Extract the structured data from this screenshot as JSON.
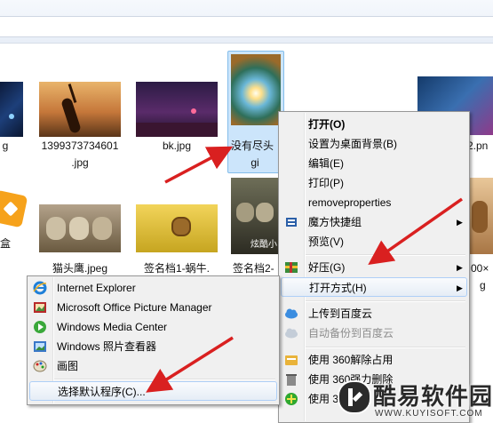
{
  "files": [
    {
      "name_line1": "g",
      "name_line2": ""
    },
    {
      "name_line1": "1399373734601",
      "name_line2": ".jpg"
    },
    {
      "name_line1": "bk.jpg",
      "name_line2": ""
    },
    {
      "name_line1": "没有尽头",
      "name_line2": "gi"
    },
    {
      "name_line1": "2.pn",
      "name_line2": ""
    },
    {
      "name_line1": "盒",
      "name_line2": "g"
    },
    {
      "name_line1": "猫头鹰.jpeg",
      "name_line2": ""
    },
    {
      "name_line1": "签名档1-蜗牛.",
      "name_line2": ""
    },
    {
      "name_line1": "签名档2-",
      "name_line2": ""
    },
    {
      "name_line1": "00×",
      "name_line2": "g"
    }
  ],
  "thumb_texts": {
    "owl2": "炫酷小"
  },
  "context_menu": {
    "items": [
      {
        "label": "打开(O)",
        "bold": true
      },
      {
        "label": "设置为桌面背景(B)"
      },
      {
        "label": "编辑(E)"
      },
      {
        "label": "打印(P)"
      },
      {
        "label": "removeproperties"
      },
      {
        "label": "魔方快捷组",
        "submenu": true,
        "icon": "cube-icon"
      },
      {
        "label": "预览(V)"
      },
      {
        "label": "好压(G)",
        "submenu": true,
        "icon": "haozip-icon"
      },
      {
        "label": "打开方式(H)",
        "submenu": true,
        "highlighted": true
      },
      {
        "label": "上传到百度云",
        "icon": "baidu-cloud-icon"
      },
      {
        "label": "自动备份到百度云",
        "disabled": true,
        "icon": "baidu-cloud-icon"
      },
      {
        "label": "使用 360解除占用",
        "icon": "360-unlock-icon"
      },
      {
        "label": "使用 360强力删除",
        "icon": "360-delete-icon"
      },
      {
        "label": "使用 3",
        "icon": "360-scan-icon"
      }
    ]
  },
  "open_with_menu": {
    "items": [
      {
        "label": "Internet Explorer",
        "icon": "internet-explorer-icon"
      },
      {
        "label": "Microsoft Office Picture Manager",
        "icon": "picture-manager-icon"
      },
      {
        "label": "Windows Media Center",
        "icon": "media-center-icon"
      },
      {
        "label": "Windows 照片查看器",
        "icon": "photo-viewer-icon"
      },
      {
        "label": "画图",
        "icon": "paint-icon"
      },
      {
        "label": "选择默认程序(C)...",
        "highlighted": true
      }
    ]
  },
  "watermark": {
    "main": "酷易软件园",
    "sub": "WWW.KUYISOFT.COM"
  },
  "colors": {
    "highlight_border": "#aecff7",
    "arrow": "#d92020",
    "selection": "#cce5fb"
  }
}
